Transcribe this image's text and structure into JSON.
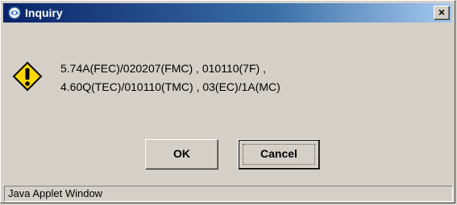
{
  "window": {
    "title": "Inquiry",
    "close_label": "×"
  },
  "dialog": {
    "icon": "warning-icon",
    "message_lines": [
      "5.74A(FEC)/020207(FMC) , 010110(7F) ,",
      "4.60Q(TEC)/010110(TMC) , 03(EC)/1A(MC)"
    ]
  },
  "buttons": {
    "ok_label": "OK",
    "cancel_label": "Cancel"
  },
  "status": {
    "text": "Java Applet Window"
  },
  "colors": {
    "title_start": "#0a246a",
    "title_end": "#a6caf0",
    "warning_fill": "#ffd700"
  }
}
